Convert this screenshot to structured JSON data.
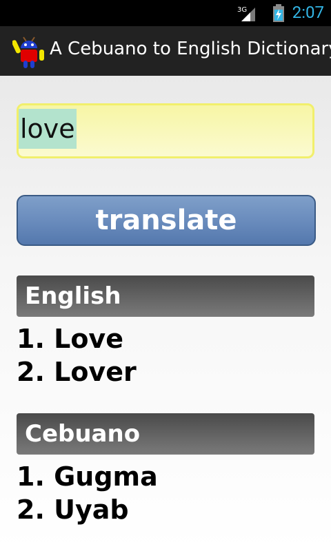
{
  "status_bar": {
    "network": "3G",
    "time": "2:07"
  },
  "app": {
    "title": "A Cebuano to English Dictionary"
  },
  "search": {
    "value": "love"
  },
  "translate_button": {
    "label": "translate"
  },
  "english": {
    "header": "English",
    "results": [
      "1. Love",
      "2. Lover"
    ]
  },
  "cebuano": {
    "header": "Cebuano",
    "results": [
      "1. Gugma",
      "2. Uyab"
    ]
  },
  "colors": {
    "status_accent": "#33b5e5",
    "input_highlight": "#f1ef6b",
    "button_blue": "#6a8cbd",
    "header_gray": "#5f5f5f"
  }
}
